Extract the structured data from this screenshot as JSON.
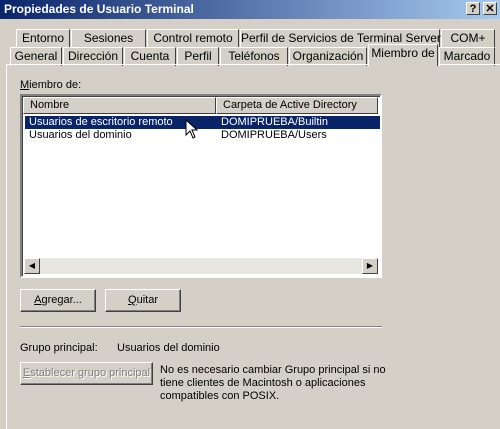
{
  "window": {
    "title": "Propiedades de Usuario Terminal",
    "help_label": "?",
    "close_label": "✕"
  },
  "tabs_row1": [
    {
      "label": "Entorno"
    },
    {
      "label": "Sesiones"
    },
    {
      "label": "Control remoto"
    },
    {
      "label": "Perfil de Servicios de Terminal Server"
    },
    {
      "label": "COM+"
    }
  ],
  "tabs_row2": [
    {
      "label": "General"
    },
    {
      "label": "Dirección"
    },
    {
      "label": "Cuenta"
    },
    {
      "label": "Perfil"
    },
    {
      "label": "Teléfonos"
    },
    {
      "label": "Organización"
    },
    {
      "label": "Miembro de",
      "active": true
    },
    {
      "label": "Marcado"
    }
  ],
  "member_of": {
    "label_prefix": "M",
    "label_rest": "iembro de:",
    "columns": [
      "Nombre",
      "Carpeta de Active Directory"
    ],
    "rows": [
      {
        "name": "Usuarios de escritorio remoto",
        "folder": "DOMIPRUEBA/Builtin",
        "selected": true
      },
      {
        "name": "Usuarios del dominio",
        "folder": "DOMIPRUEBA/Users",
        "selected": false
      }
    ],
    "scroll_left_icon": "arrow-left-icon",
    "scroll_right_icon": "arrow-right-icon"
  },
  "buttons": {
    "add_u": "A",
    "add_rest": "gregar...",
    "remove_pre": "",
    "remove_u": "Q",
    "remove_rest": "uitar"
  },
  "primary_group": {
    "label": "Grupo principal:",
    "value": "Usuarios del dominio",
    "set_button_pre": "",
    "set_button_u": "E",
    "set_button_rest": "stablecer grupo principal",
    "note": "No es necesario cambiar Grupo principal si no tiene clientes de Macintosh o aplicaciones compatibles con POSIX."
  }
}
